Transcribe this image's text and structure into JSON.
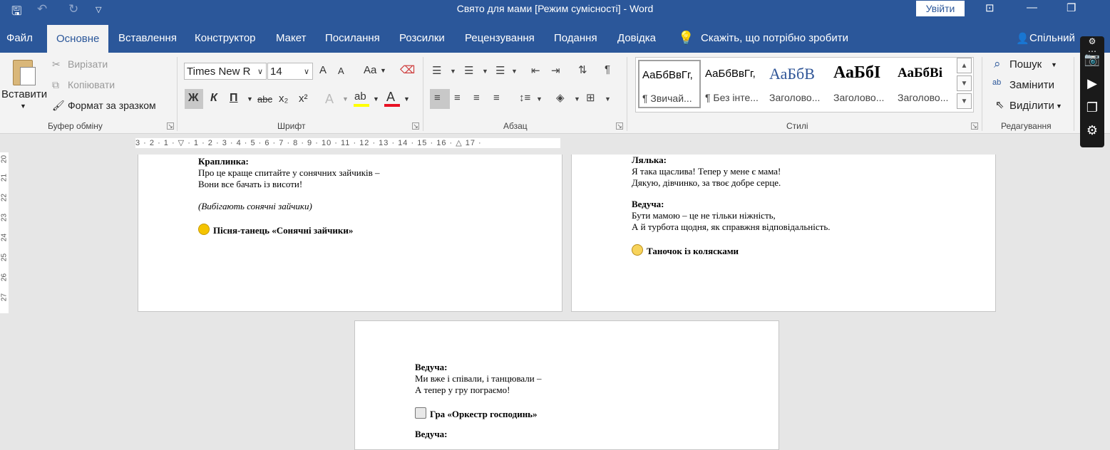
{
  "titlebar": {
    "title": "Свято для мами [Режим сумісності]  -  Word",
    "signin": "Увійти"
  },
  "tabs": [
    "Файл",
    "Основне",
    "Вставлення",
    "Конструктор",
    "Макет",
    "Посилання",
    "Розсилки",
    "Рецензування",
    "Подання",
    "Довідка"
  ],
  "tell_me": "Скажіть, що потрібно зробити",
  "share": "Спільний",
  "clipboard": {
    "paste": "Вставити",
    "cut": "Вирізати",
    "copy": "Копіювати",
    "format_painter": "Формат за зразком",
    "label": "Буфер обміну"
  },
  "font": {
    "name": "Times New R",
    "size": "14",
    "label": "Шрифт",
    "bold": "Ж",
    "italic": "К",
    "underline": "П",
    "strike": "abc",
    "sub": "x₂",
    "sup": "x²",
    "case": "Aa",
    "grow": "A",
    "shrink": "A"
  },
  "paragraph": {
    "label": "Абзац"
  },
  "styles": {
    "label": "Стилі",
    "items": [
      {
        "preview": "АаБбВвГг,",
        "name": "¶ Звичай..."
      },
      {
        "preview": "АаБбВвГг,",
        "name": "¶ Без інте..."
      },
      {
        "preview": "АаБбВ",
        "name": "Заголово..."
      },
      {
        "preview": "АаБбІ",
        "name": "Заголово..."
      },
      {
        "preview": "АаБбВі",
        "name": "Заголово..."
      }
    ]
  },
  "editing": {
    "find": "Пошук",
    "replace": "Замінити",
    "select": "Виділити",
    "label": "Редагування"
  },
  "ruler": "3 · 2 · 1 · ▽ · 1 · 2 · 3 · 4 · 5 · 6 · 7 · 8 · 9 · 10 · 11 · 12 · 13 · 14 · 15 · 16 · △ 17 ·",
  "vruler": [
    "20",
    "21",
    "22",
    "23",
    "24",
    "25",
    "26",
    "27"
  ],
  "page_left": {
    "speaker1": "Краплинка:",
    "line1": "Про це краще спитайте у сонячних зайчиків –",
    "line2": "Вони все бачать із висоти!",
    "stage": "(Вибігають сонячні зайчики)",
    "song": "Пісня-танець «Сонячні зайчики»"
  },
  "page_right": {
    "speaker1": "Лялька:",
    "line1": "Я така щаслива! Тепер у мене є мама!",
    "line2": "Дякую, дівчинко, за твоє добре серце.",
    "speaker2": "Ведуча:",
    "line3": "Бути мамою – це не тільки ніжність,",
    "line4": "А й турбота щодня, як справжня відповідальність.",
    "dance": "Таночок із колясками"
  },
  "page_bottom": {
    "speaker1": "Ведуча:",
    "line1": "Ми вже і співали, і танцювали –",
    "line2": "А тепер у гру пограємо!",
    "game": "Гра «Оркестр господинь»",
    "speaker2": "Ведуча:"
  },
  "colors": {
    "brand": "#2b579a",
    "highlight": "#ffff00",
    "font_color": "#e81123"
  }
}
